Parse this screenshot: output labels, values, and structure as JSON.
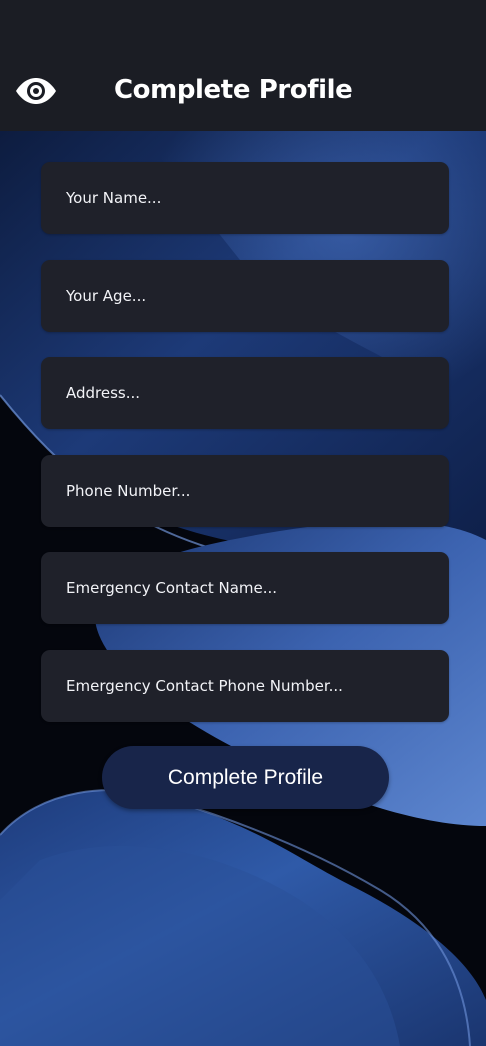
{
  "header": {
    "title": "Complete Profile",
    "logo_icon": "eye-icon"
  },
  "form": {
    "fields": [
      {
        "placeholder": "Your Name..."
      },
      {
        "placeholder": "Your Age..."
      },
      {
        "placeholder": "Address..."
      },
      {
        "placeholder": "Phone Number..."
      },
      {
        "placeholder": "Emergency Contact Name..."
      },
      {
        "placeholder": "Emergency Contact Phone Number..."
      }
    ],
    "submit_label": "Complete Profile"
  },
  "colors": {
    "app_bar": "#1b1d24",
    "field_bg": "#1f212a",
    "button_bg": "#18254a",
    "wallpaper_blue": "#2a4a8c",
    "wallpaper_dark": "#04060d"
  }
}
